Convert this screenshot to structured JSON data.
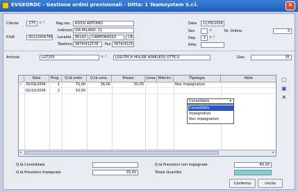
{
  "window": {
    "title": "EVGEORDC - Gestione ordini previsionali - Ditta: 1 Teamsystem S.r.l."
  },
  "header": {
    "cliente_label": "Cliente",
    "cliente_value": "275",
    "ragsoc_label": "Rag.soc.",
    "ragsoc_value": "ROSSI ANTONIO",
    "indirizzo_label": "Indirizzo",
    "indirizzo_value": "VIA MILANO, 11",
    "piva_label": "P.IVA",
    "piva_value": "00123456785412",
    "localita_label": "Località",
    "cap_value": "86100",
    "localita_value": "CAMPOBASSO",
    "prov_value": "CB",
    "telefono_label": "Telefono",
    "telefono_value": "0874/412578",
    "fax_label": "Fax",
    "fax_value": "0874/412578",
    "data_label": "Data",
    "data_value": "11/09/2006",
    "sez_label": "Sez.",
    "nordine_label": "Nr. Ordine",
    "nordine_value": "3",
    "dep_label": "Dep.",
    "dep_value": "2",
    "rifer_label": "Rifer."
  },
  "articolo": {
    "label": "Articolo",
    "code": "LGT255",
    "description": "LOGITECH MOUSE WIRELESS OTTICO",
    "giac_label": "Giac.",
    "giac_value": "35"
  },
  "grid": {
    "columns": [
      "Data",
      "Prog.",
      "Q.tà ordin.",
      "Q.tà cons.",
      "Prezzo",
      "Linea",
      "Riferim.",
      "Tipologia",
      "Note"
    ],
    "rows": [
      {
        "marker": "»",
        "data": "30/09/2006",
        "prog": "1",
        "qta_ordin": "70,00",
        "qta_cons": "36,00",
        "prezzo": "30,00",
        "linea": "",
        "riferim": "",
        "tipologia": "Non impegnativo",
        "note": ""
      },
      {
        "marker": "",
        "data": "02/10/2006",
        "prog": "2",
        "qta_ordin": "10,00",
        "qta_cons": "",
        "prezzo": "",
        "linea": "",
        "riferim": "",
        "tipologia": "Consolidato",
        "note": ""
      }
    ],
    "dropdown_options": [
      "Consolidato",
      "Impegnativo",
      "Non impegnativo"
    ],
    "dropdown_selected": "Consolidato"
  },
  "totals": {
    "consolidate_label": "Q.tà Consolidate",
    "consolidate_value": "",
    "impegnate_label": "Q.tà Previsioni impegnate",
    "impegnate_value": "35,00",
    "non_impegnate_label": "Q.tà Previsioni non impegnate",
    "non_impegnate_value": "80,00",
    "totale_label": "Totale Quantità",
    "totale_value": ""
  },
  "buttons": {
    "conferma": "Conferma",
    "uscita": "Uscita"
  }
}
